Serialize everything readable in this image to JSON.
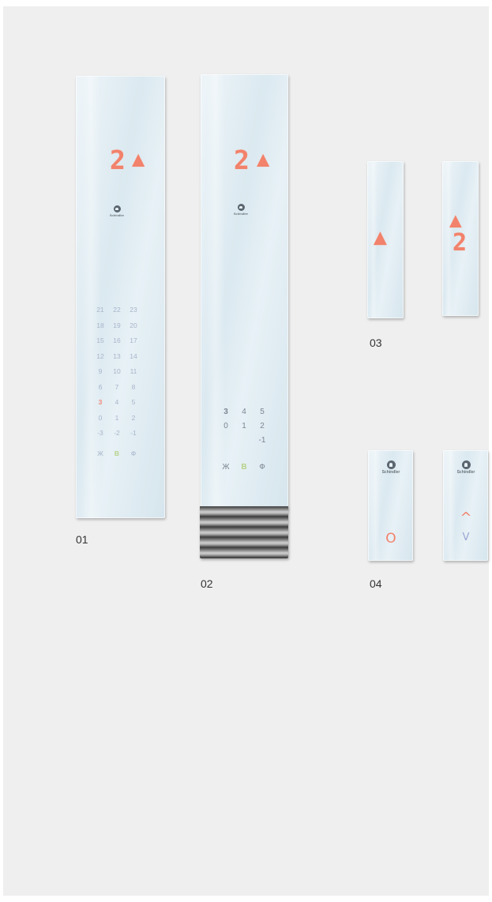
{
  "captions": {
    "c01": "01",
    "c02": "02",
    "c03": "03",
    "c04": "04"
  },
  "display": {
    "floor": "2",
    "arrow": "▲"
  },
  "logo": {
    "brand": "Schindler"
  },
  "keypad01": {
    "rows": [
      [
        "21",
        "22",
        "23"
      ],
      [
        "18",
        "19",
        "20"
      ],
      [
        "15",
        "16",
        "17"
      ],
      [
        "12",
        "13",
        "14"
      ],
      [
        "9",
        "10",
        "11"
      ],
      [
        "6",
        "7",
        "8"
      ],
      [
        "3",
        "4",
        "5"
      ],
      [
        "0",
        "1",
        "2"
      ],
      [
        "-3",
        "-2",
        "-1"
      ]
    ],
    "special": [
      "Ж",
      "B",
      "Ф"
    ]
  },
  "keypad02": {
    "rows": [
      [
        "3",
        "4",
        "5"
      ],
      [
        "0",
        "1",
        "2"
      ],
      [
        "",
        "",
        "-1"
      ]
    ],
    "special": [
      "Ж",
      "B",
      "Ф"
    ]
  },
  "buttons04": {
    "call": "O",
    "up": "^",
    "down": "V"
  },
  "colors": {
    "led": "#f2826b",
    "key": "#a8b4ca",
    "background": "#efefef"
  }
}
